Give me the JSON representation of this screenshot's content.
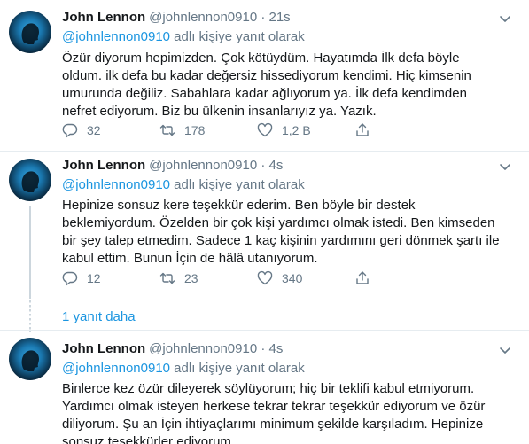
{
  "tweets": [
    {
      "name": "John Lennon",
      "handle": "@johnlennon0910",
      "time": "21s",
      "replying_mention": "@johnlennon0910",
      "replying_suffix": "adlı kişiye yanıt olarak",
      "lines": [
        "Özür diyorum hepimizden. Çok kötüydüm. Hayatımda İlk defa böyle",
        "oldum. ilk defa bu kadar değersiz hissediyorum kendimi. Hiç kimsenin",
        "umurunda değiliz. Sabahlara kadar ağlıyorum ya. İlk defa kendimden",
        "nefret ediyorum. Biz bu ülkenin insanlarıyız ya. Yazık."
      ],
      "replies": "32",
      "retweets": "178",
      "likes": "1,2 B"
    },
    {
      "name": "John Lennon",
      "handle": "@johnlennon0910",
      "time": "4s",
      "replying_mention": "@johnlennon0910",
      "replying_suffix": "adlı kişiye yanıt olarak",
      "lines": [
        "Hepinize sonsuz kere teşekkür ederim. Ben böyle bir destek",
        "beklemiyordum. Özelden bir çok kişi yardımcı olmak istedi. Ben kimseden",
        "bir şey talep etmedim. Sadece 1 kaç kişinin yardımını geri dönmek şartı ile",
        "kabul ettim. Bunun İçin de hâlâ utanıyorum."
      ],
      "replies": "12",
      "retweets": "23",
      "likes": "340"
    },
    {
      "name": "John Lennon",
      "handle": "@johnlennon0910",
      "time": "4s",
      "replying_mention": "@johnlennon0910",
      "replying_suffix": "adlı kişiye yanıt olarak",
      "lines": [
        "Binlerce kez özür dileyerek söylüyorum; hiç bir teklifi kabul etmiyorum.",
        "Yardımcı olmak isteyen herkese tekrar tekrar teşekkür ediyorum ve özür",
        "diliyorum. Şu an İçin ihtiyaçlarımı minimum şekilde karşıladım. Hepinize",
        "sonsuz teşekkürler ediyorum."
      ]
    }
  ],
  "dot": "·",
  "more_replies": "1 yanıt daha",
  "colors": {
    "accent": "#1b95e0",
    "muted": "#657786",
    "text": "#14171a",
    "border": "#e6ecf0"
  },
  "icons": [
    "reply-icon",
    "retweet-icon",
    "like-icon",
    "share-icon",
    "caret-down-icon"
  ]
}
